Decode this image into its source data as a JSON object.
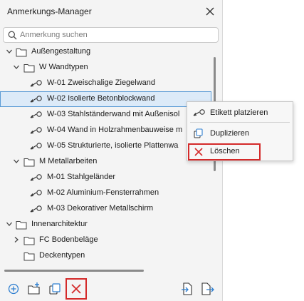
{
  "window": {
    "title": "Anmerkungs-Manager"
  },
  "search": {
    "placeholder": "Anmerkung suchen"
  },
  "tree": {
    "rows": [
      {
        "label": "Außengestaltung",
        "kind": "folder",
        "expanded": true,
        "level": 0
      },
      {
        "label": "W Wandtypen",
        "kind": "folder",
        "expanded": true,
        "level": 1
      },
      {
        "label": "W-01 Zweischalige Ziegelwand",
        "kind": "note",
        "level": 2
      },
      {
        "label": "W-02 Isolierte Betonblockwand",
        "kind": "note",
        "level": 2,
        "selected": true
      },
      {
        "label": "W-03 Stahlständerwand mit Außenisol",
        "kind": "note",
        "level": 2
      },
      {
        "label": "W-04 Wand in Holzrahmenbauweise m",
        "kind": "note",
        "level": 2
      },
      {
        "label": "W-05 Strukturierte, isolierte Plattenwa",
        "kind": "note",
        "level": 2
      },
      {
        "label": "M Metallarbeiten",
        "kind": "folder",
        "expanded": true,
        "level": 1
      },
      {
        "label": "M-01 Stahlgeländer",
        "kind": "note",
        "level": 2
      },
      {
        "label": "M-02 Aluminium-Fensterrahmen",
        "kind": "note",
        "level": 2
      },
      {
        "label": "M-03 Dekorativer Metallschirm",
        "kind": "note",
        "level": 2
      },
      {
        "label": "Innenarchitektur",
        "kind": "folder",
        "expanded": true,
        "level": 0
      },
      {
        "label": "FC Bodenbeläge",
        "kind": "folder",
        "expanded": false,
        "level": 1
      },
      {
        "label": "Deckentypen",
        "kind": "folder",
        "expanded": false,
        "level": 1
      }
    ]
  },
  "context_menu": {
    "place_label": "Etikett platzieren",
    "duplicate_label": "Duplizieren",
    "delete_label": "Löschen"
  },
  "colors": {
    "accent": "#2f7fd0",
    "selection_bg": "#dceaf8",
    "selection_border": "#5b9bd5",
    "delete_red": "#d42a2a",
    "highlight_box": "#d42a2a"
  }
}
